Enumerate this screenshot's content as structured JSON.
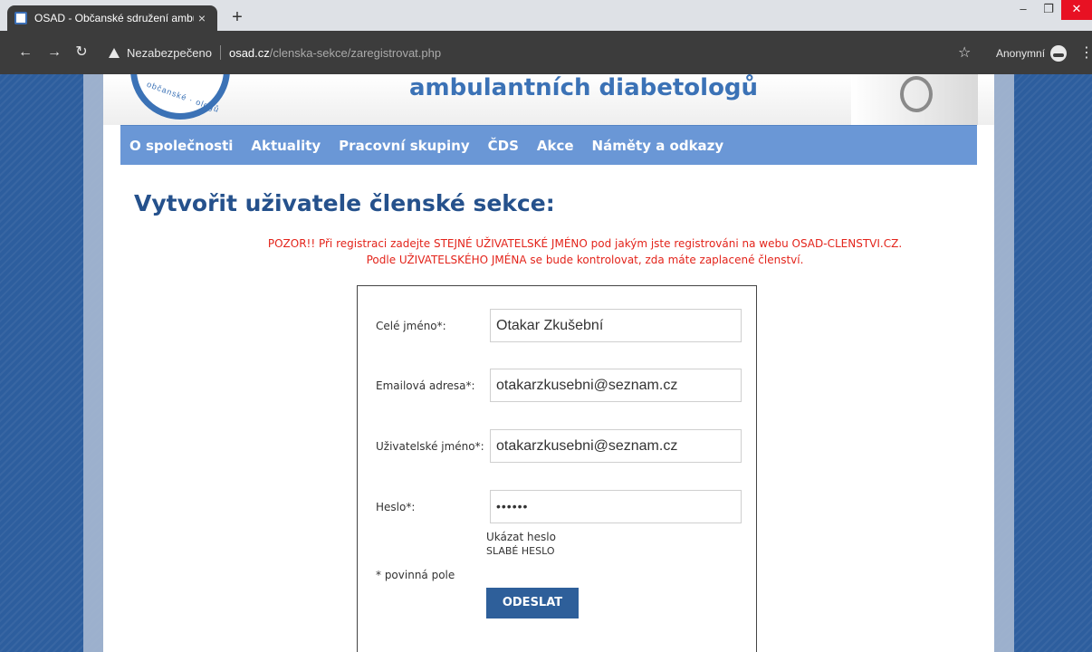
{
  "browser": {
    "tab_title": "OSAD - Občanské sdružení ambu",
    "tab_close": "×",
    "new_tab": "+",
    "address_warning": "Nezabezpečeno",
    "address_host": "osad.cz",
    "address_path": "/clenska-sekce/zaregistrovat.php",
    "profile_label": "Anonymní",
    "back_icon": "arrow-left",
    "forward_icon": "arrow-right",
    "reload_icon": "reload",
    "star_icon": "star",
    "menu_icon": "vertical-dots"
  },
  "window_controls": {
    "minimize": "–",
    "restore": "❐",
    "close": "✕"
  },
  "header": {
    "site_name": "ambulantních diabetologů",
    "logo_text": "občanské · ologů"
  },
  "nav": {
    "items": [
      {
        "label": "O společnosti"
      },
      {
        "label": "Aktuality"
      },
      {
        "label": "Pracovní skupiny"
      },
      {
        "label": "ČDS"
      },
      {
        "label": "Akce"
      },
      {
        "label": "Náměty a odkazy"
      }
    ]
  },
  "main": {
    "title": "Vytvořit uživatele členské sekce:",
    "warning_line1": "POZOR!! Při registraci zadejte STEJNÉ UŽIVATELSKÉ JMÉNO pod jakým jste registrováni na webu OSAD-CLENSTVI.CZ.",
    "warning_line2": "Podle UŽIVATELSKÉHO JMÉNA se bude kontrolovat, zda máte zaplacené členství."
  },
  "form": {
    "full_name_label": "Celé jméno*:",
    "full_name_value": "Otakar Zkušební",
    "email_label": "Emailová adresa*:",
    "email_value": "otakarzkusebni@seznam.cz",
    "username_label": "Uživatelské jméno*:",
    "username_value": "otakarzkusebni@seznam.cz",
    "password_label": "Heslo*:",
    "password_value": "••••••",
    "show_password": "Ukázat heslo",
    "password_strength": "SLABÉ HESLO",
    "required_note": "* povinná pole",
    "submit_label": "ODESLAT"
  },
  "colors": {
    "nav_bg": "#6a97d6",
    "title": "#25518c",
    "warning": "#e3241b",
    "submit_bg": "#2e5f9a",
    "page_bg": "#2d5e9e"
  }
}
